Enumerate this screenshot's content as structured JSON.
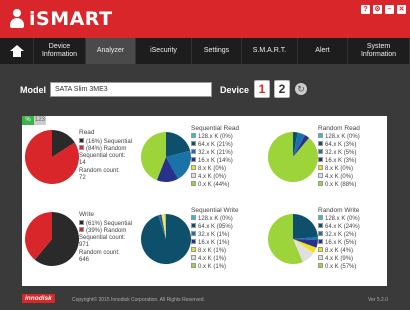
{
  "app": {
    "name": "iSMART"
  },
  "window_controls": [
    {
      "name": "help-icon",
      "glyph": "?"
    },
    {
      "name": "settings-icon",
      "glyph": "⚙"
    },
    {
      "name": "minimize-icon",
      "glyph": "–"
    },
    {
      "name": "close-icon",
      "glyph": "✕"
    }
  ],
  "nav": {
    "items": [
      {
        "label": "Device\nInformation",
        "width": 52
      },
      {
        "label": "Analyzer",
        "width": 50,
        "active": true
      },
      {
        "label": "iSecurity",
        "width": 56
      },
      {
        "label": "Settings",
        "width": 50
      },
      {
        "label": "S.M.A.R.T.",
        "width": 56
      },
      {
        "label": "Alert",
        "width": 50
      },
      {
        "label": "System\nInformation",
        "width": 62
      }
    ]
  },
  "model": {
    "label": "Model",
    "value": "SATA Slim 3ME3"
  },
  "device": {
    "label": "Device",
    "buttons": [
      "1",
      "2"
    ]
  },
  "toggle": {
    "on": "%",
    "off": "123"
  },
  "colors": {
    "read_seq": "#2a2a2a",
    "read_rand": "#d9262b",
    "k128": "#24c1d9",
    "k64": "#0e4f6b",
    "k32": "#1a73a8",
    "k16": "#29318e",
    "k8": "#f2e21e",
    "k4": "#e0e0e0",
    "k0": "#9dd43a"
  },
  "read": {
    "title": "Read",
    "legend": [
      "(16%) Sequential",
      "(84%) Random"
    ],
    "seq_count_label": "Sequential count:",
    "seq_count": "14",
    "rand_count_label": "Random count:",
    "rand_count": "72",
    "pie": [
      16,
      84
    ]
  },
  "write": {
    "title": "Write",
    "legend": [
      "(61%) Sequential",
      "(39%) Random"
    ],
    "seq_count_label": "Sequential count:",
    "seq_count": "971",
    "rand_count_label": "Random count:",
    "rand_count": "646",
    "pie": [
      61,
      39
    ]
  },
  "seq_read": {
    "title": "Sequential Read",
    "rows": [
      {
        "label": "128.x K",
        "pct": "(0%)"
      },
      {
        "label": "64.x K",
        "pct": "(21%)"
      },
      {
        "label": "32.x K",
        "pct": "(21%)"
      },
      {
        "label": "16.x K",
        "pct": "(14%)"
      },
      {
        "label": "8.x K",
        "pct": "(0%)"
      },
      {
        "label": "4.x K",
        "pct": "(0%)"
      },
      {
        "label": "0.x K",
        "pct": "(44%)"
      }
    ],
    "pie": [
      0,
      21,
      21,
      14,
      0,
      0,
      44
    ]
  },
  "rand_read": {
    "title": "Random Read",
    "rows": [
      {
        "label": "128.x K",
        "pct": "(0%)"
      },
      {
        "label": "64.x K",
        "pct": "(3%)"
      },
      {
        "label": "32.x K",
        "pct": "(5%)"
      },
      {
        "label": "16.x K",
        "pct": "(3%)"
      },
      {
        "label": "8.x K",
        "pct": "(0%)"
      },
      {
        "label": "4.x K",
        "pct": "(0%)"
      },
      {
        "label": "0.x K",
        "pct": "(88%)"
      }
    ],
    "pie": [
      0,
      3,
      5,
      3,
      0,
      0,
      88
    ]
  },
  "seq_write": {
    "title": "Sequential Write",
    "rows": [
      {
        "label": "128.x K",
        "pct": "(0%)"
      },
      {
        "label": "64.x K",
        "pct": "(95%)"
      },
      {
        "label": "32.x K",
        "pct": "(1%)"
      },
      {
        "label": "16.x K",
        "pct": "(1%)"
      },
      {
        "label": "8.x K",
        "pct": "(1%)"
      },
      {
        "label": "4.x K",
        "pct": "(1%)"
      },
      {
        "label": "0.x K",
        "pct": "(1%)"
      }
    ],
    "pie": [
      0,
      95,
      1,
      1,
      1,
      1,
      1
    ]
  },
  "rand_write": {
    "title": "Random Write",
    "rows": [
      {
        "label": "128.x K",
        "pct": "(0%)"
      },
      {
        "label": "64.x K",
        "pct": "(24%)"
      },
      {
        "label": "32.x K",
        "pct": "(2%)"
      },
      {
        "label": "16.x K",
        "pct": "(5%)"
      },
      {
        "label": "8.x K",
        "pct": "(4%)"
      },
      {
        "label": "4.x K",
        "pct": "(9%)"
      },
      {
        "label": "0.x K",
        "pct": "(57%)"
      }
    ],
    "pie": [
      0,
      24,
      2,
      5,
      4,
      9,
      57
    ]
  },
  "footer": {
    "logo": "innodisk",
    "copyright": "Copyright© 2015 Innodisk Corporation. All Rights Reserved.",
    "version": "Ver 5.2.0"
  }
}
